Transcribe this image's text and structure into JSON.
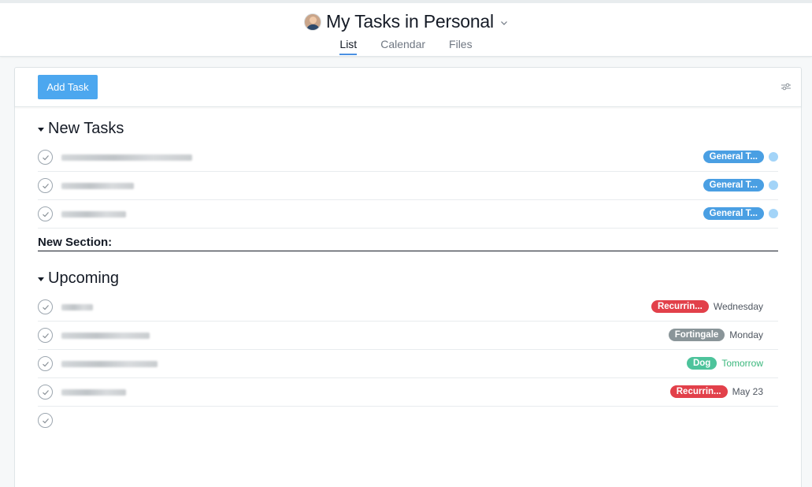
{
  "header": {
    "title": "My Tasks in Personal",
    "tabs": [
      {
        "label": "List",
        "active": true
      },
      {
        "label": "Calendar",
        "active": false
      },
      {
        "label": "Files",
        "active": false
      }
    ]
  },
  "toolbar": {
    "add_task_label": "Add Task"
  },
  "sections": {
    "new_tasks": {
      "title": "New Tasks",
      "tasks": [
        {
          "tag": "General T...",
          "tag_color": "#4a9fe3"
        },
        {
          "tag": "General T...",
          "tag_color": "#4a9fe3"
        },
        {
          "tag": "General T...",
          "tag_color": "#4a9fe3"
        }
      ]
    },
    "new_section": {
      "title": "New Section:"
    },
    "upcoming": {
      "title": "Upcoming",
      "tasks": [
        {
          "tag": "Recurrin...",
          "tag_color": "#e2404a",
          "due": "Wednesday"
        },
        {
          "tag": "Fortingale",
          "tag_color": "#8a9599",
          "due": "Monday"
        },
        {
          "tag": "Dog",
          "tag_color": "#4dc39b",
          "due": "Tomorrow"
        },
        {
          "tag": "Recurrin...",
          "tag_color": "#e2404a",
          "due": "May 23"
        }
      ]
    }
  },
  "colors": {
    "accent": "#4ca7ef",
    "tab_underline": "#4a90e2",
    "dot": "#a3d4f8",
    "due_soon": "#3ab77c"
  },
  "icons": [
    "avatar",
    "chevron-down-icon",
    "filter-icon",
    "caret-down-icon",
    "check-icon"
  ]
}
